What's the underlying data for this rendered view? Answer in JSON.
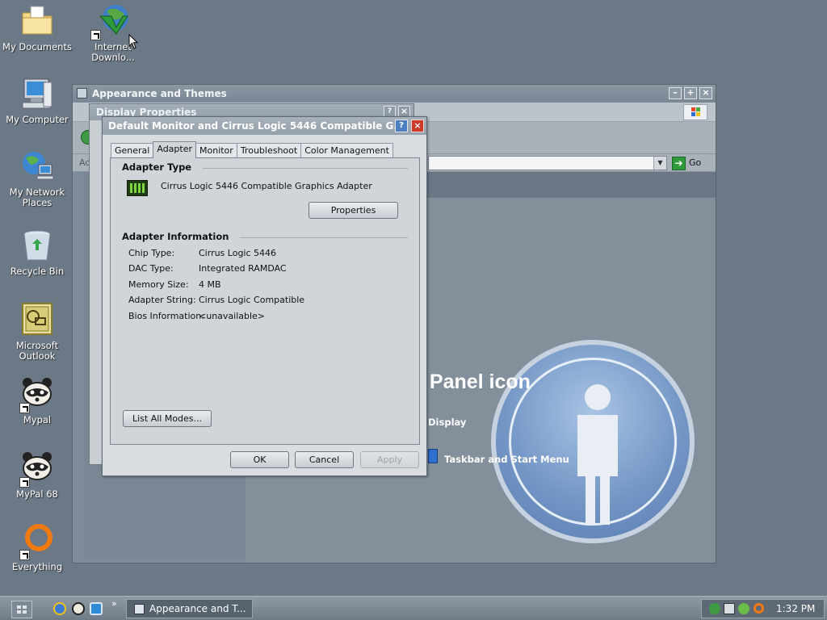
{
  "desktop": {
    "icons": [
      {
        "label": "My Documents"
      },
      {
        "label": "Internet Downlo..."
      },
      {
        "label": "My Computer"
      },
      {
        "label": "My Network Places"
      },
      {
        "label": "Recycle Bin"
      },
      {
        "label": "Microsoft Outlook"
      },
      {
        "label": "Mypal"
      },
      {
        "label": "MyPal 68"
      },
      {
        "label": "Everything"
      }
    ]
  },
  "background_window": {
    "title": "Appearance and Themes",
    "address_label": "Ad",
    "go_label": "Go",
    "heading_partial": "l Panel icon",
    "links": [
      {
        "label": "Display"
      },
      {
        "label": "Taskbar and Start Menu"
      }
    ]
  },
  "display_properties": {
    "title": "Display Properties"
  },
  "adapter_dialog": {
    "title": "Default Monitor and Cirrus Logic 5446 Compatible G...",
    "tabs": [
      {
        "label": "General",
        "active": false
      },
      {
        "label": "Adapter",
        "active": true
      },
      {
        "label": "Monitor",
        "active": false
      },
      {
        "label": "Troubleshoot",
        "active": false
      },
      {
        "label": "Color Management",
        "active": false
      }
    ],
    "adapter_type": {
      "heading": "Adapter Type",
      "name": "Cirrus Logic 5446 Compatible Graphics Adapter",
      "properties_button": "Properties"
    },
    "adapter_info": {
      "heading": "Adapter Information",
      "rows": [
        {
          "label": "Chip Type:",
          "value": "Cirrus Logic 5446"
        },
        {
          "label": "DAC Type:",
          "value": "Integrated RAMDAC"
        },
        {
          "label": "Memory Size:",
          "value": "4 MB"
        },
        {
          "label": "Adapter String:",
          "value": "Cirrus Logic Compatible"
        },
        {
          "label": "Bios Information:",
          "value": "<unavailable>"
        }
      ]
    },
    "list_modes_button": "List All Modes...",
    "buttons": {
      "ok": "OK",
      "cancel": "Cancel",
      "apply": "Apply"
    }
  },
  "taskbar": {
    "chevron": "»",
    "task_button": "Appearance and T...",
    "clock": "1:32 PM"
  },
  "colors": {
    "desktop": "#6b7886",
    "dialog_face": "#d9dde1",
    "close_red": "#cc3a2a",
    "help_blue": "#4b7fc2"
  }
}
